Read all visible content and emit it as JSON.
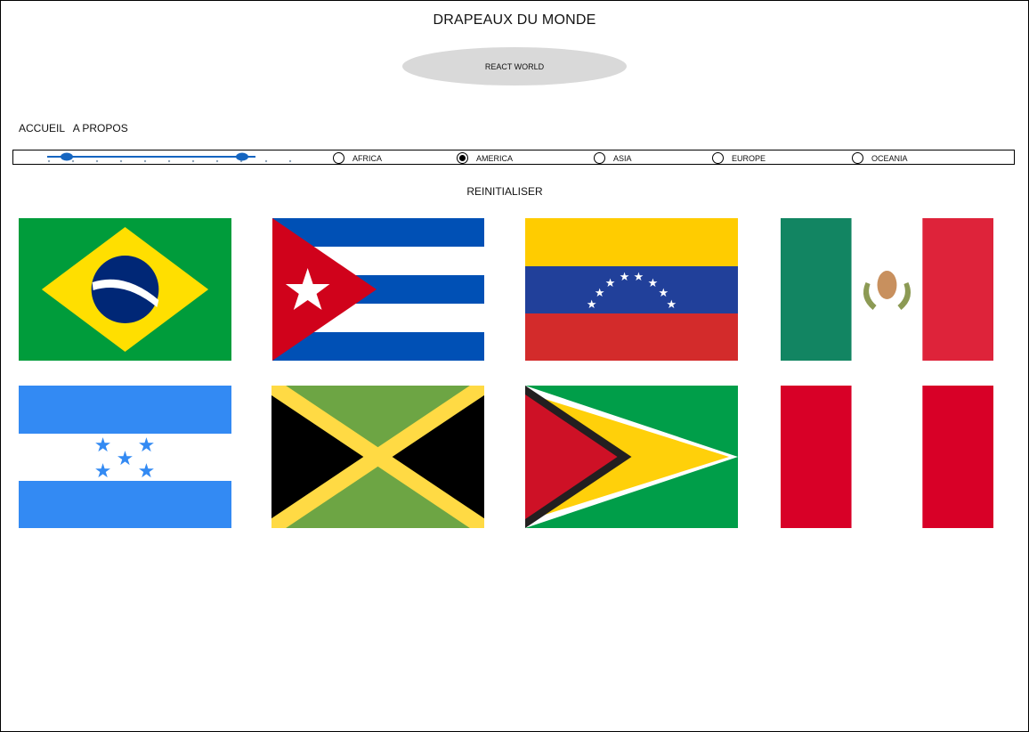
{
  "header": {
    "title": "DRAPEAUX DU MONDE",
    "badge": "REACT WORLD"
  },
  "nav": {
    "items": [
      "ACCUEIL",
      "A PROPOS"
    ]
  },
  "filter": {
    "slider": {
      "min_value": 0.0,
      "max_value": 1.0,
      "marks": 10
    },
    "regions": [
      {
        "label": "AFRICA",
        "selected": false
      },
      {
        "label": "AMERICA",
        "selected": true
      },
      {
        "label": "ASIA",
        "selected": false
      },
      {
        "label": "EUROPE",
        "selected": false
      },
      {
        "label": "OCEANIA",
        "selected": false
      }
    ],
    "reset_label": "REINITIALISER"
  },
  "flags": [
    {
      "country": "brazil",
      "icon": "brazil-flag-icon"
    },
    {
      "country": "cuba",
      "icon": "cuba-flag-icon"
    },
    {
      "country": "venezuela",
      "icon": "venezuela-flag-icon"
    },
    {
      "country": "mexico",
      "icon": "mexico-flag-icon"
    },
    {
      "country": "honduras",
      "icon": "honduras-flag-icon"
    },
    {
      "country": "jamaica",
      "icon": "jamaica-flag-icon"
    },
    {
      "country": "guyana",
      "icon": "guyana-flag-icon"
    },
    {
      "country": "peru",
      "icon": "peru-flag-icon"
    }
  ],
  "colors": {
    "accent": "#1565c0",
    "badge_bg": "#d9d9d9"
  }
}
